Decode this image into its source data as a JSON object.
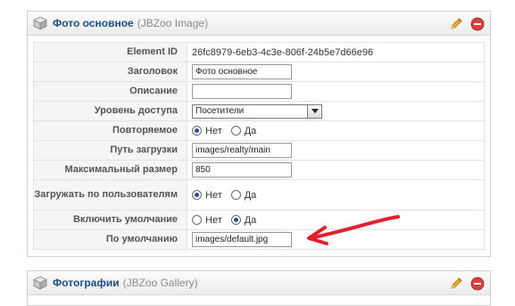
{
  "main_element": {
    "title": "Фото основное",
    "type": "(JBZoo Image)",
    "icons": [
      "cube-icon",
      "pencil-icon",
      "delete-icon"
    ],
    "rows": [
      {
        "label": "Element ID",
        "value": "26fc8979-6eb3-4c3e-806f-24b5e7d66e96"
      },
      {
        "label": "Заголовок",
        "value": "Фото основное"
      },
      {
        "label": "Описание",
        "value": ""
      },
      {
        "label": "Уровень доступа",
        "value": "Посетители"
      },
      {
        "label": "Повторяемое",
        "options": [
          "Нет",
          "Да"
        ],
        "selected": "Нет"
      },
      {
        "label": "Путь загрузки",
        "value": "images/realty/main"
      },
      {
        "label": "Максимальный размер",
        "value": "850"
      },
      {
        "label": "Загружать по пользователям",
        "options": [
          "Нет",
          "Да"
        ],
        "selected": "Нет"
      },
      {
        "label": "Включить умолчание",
        "options": [
          "Нет",
          "Да"
        ],
        "selected": "Да"
      },
      {
        "label": "По умолчанию",
        "value": "images/default.jpg"
      }
    ]
  },
  "second_element": {
    "title": "Фотографии",
    "type": "(JBZoo Gallery)"
  },
  "colors": {
    "title_link": "#1a4f8b",
    "annotation_arrow": "#e0202a",
    "delete": "#d94040",
    "pencil": "#f0b020"
  }
}
